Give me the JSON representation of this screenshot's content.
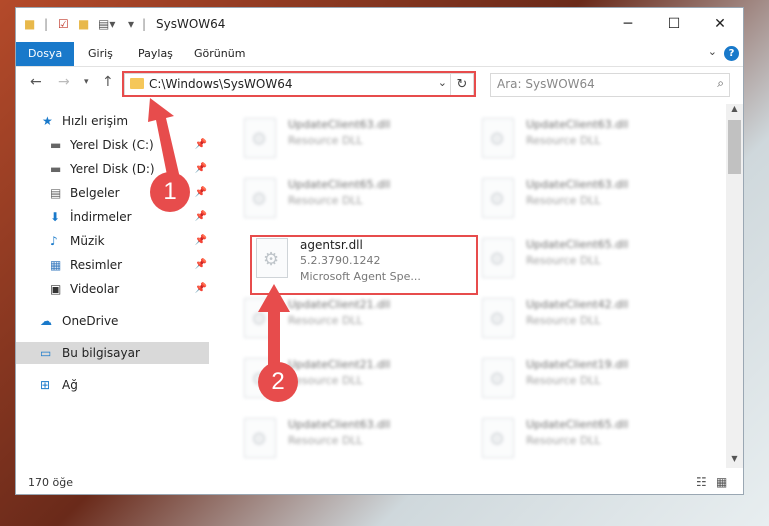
{
  "window": {
    "title": "SysWOW64",
    "controls": {
      "minimize": "─",
      "maximize": "☐",
      "close": "✕"
    }
  },
  "ribbon": {
    "tabs": [
      {
        "label": "Dosya"
      },
      {
        "label": "Giriş"
      },
      {
        "label": "Paylaş"
      },
      {
        "label": "Görünüm"
      }
    ],
    "help": "?"
  },
  "address": {
    "path": "C:\\Windows\\SysWOW64",
    "search_placeholder": "Ara: SysWOW64"
  },
  "sidebar": {
    "items": [
      {
        "label": "Hızlı erişim",
        "icon": "★"
      },
      {
        "label": "Yerel Disk (C:)",
        "icon": "▬"
      },
      {
        "label": "Yerel Disk (D:)",
        "icon": "▬"
      },
      {
        "label": "Belgeler",
        "icon": "▤"
      },
      {
        "label": "İndirmeler",
        "icon": "⬇"
      },
      {
        "label": "Müzik",
        "icon": "♪"
      },
      {
        "label": "Resimler",
        "icon": "▦"
      },
      {
        "label": "Videolar",
        "icon": "▣"
      },
      {
        "label": "OneDrive",
        "icon": "☁"
      },
      {
        "label": "Bu bilgisayar",
        "icon": "▭"
      },
      {
        "label": "Ağ",
        "icon": "⊞"
      }
    ]
  },
  "files": [
    {
      "name": "UpdateClient63.dll",
      "type": "Resource DLL"
    },
    {
      "name": "UpdateClient63.dll",
      "type": "Resource DLL"
    },
    {
      "name": "UpdateClient65.dll",
      "type": "Resource DLL"
    },
    {
      "name": "UpdateClient63.dll",
      "type": "Resource DLL"
    },
    {
      "name": "agentsr.dll",
      "version": "5.2.3790.1242",
      "type": "Microsoft Agent Spe..."
    },
    {
      "name": "UpdateClient65.dll",
      "type": "Resource DLL"
    },
    {
      "name": "UpdateClient21.dll",
      "type": "Resource DLL"
    },
    {
      "name": "UpdateClient42.dll",
      "type": "Resource DLL"
    },
    {
      "name": "UpdateClient21.dll",
      "type": "Resource DLL"
    },
    {
      "name": "UpdateClient19.dll",
      "type": "Resource DLL"
    },
    {
      "name": "UpdateClient63.dll",
      "type": "Resource DLL"
    },
    {
      "name": "UpdateClient65.dll",
      "type": "Resource DLL"
    }
  ],
  "status": {
    "count": "170 öğe"
  },
  "annotations": {
    "step1": "1",
    "step2": "2",
    "color": "#e74c4c"
  },
  "colors": {
    "accent": "#1979ca",
    "highlight": "#e74c4c"
  }
}
